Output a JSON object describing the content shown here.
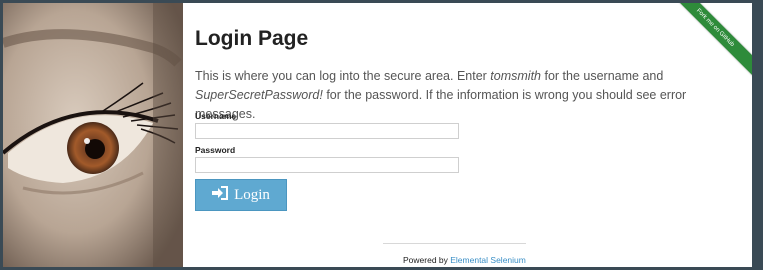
{
  "page": {
    "title": "Login Page",
    "description_parts": [
      "This is where you can log into the secure area. Enter ",
      "tomsmith",
      " for the username and ",
      "SuperSecretPassword!",
      " for the password. If the information is wrong you should see error messages."
    ]
  },
  "form": {
    "username_label": "Username",
    "username_value": "",
    "password_label": "Password",
    "password_value": "",
    "login_label": "Login",
    "login_icon": "sign-in-icon"
  },
  "footer": {
    "prefix": "Powered by ",
    "link_text": "Elemental Selenium"
  },
  "ribbon": {
    "text": "Fork me on GitHub",
    "color": "#2e8b3a"
  },
  "colors": {
    "button": "#5fa9d1",
    "link": "#3a8fc6"
  },
  "hero": {
    "image": "eye-closeup-photo"
  }
}
